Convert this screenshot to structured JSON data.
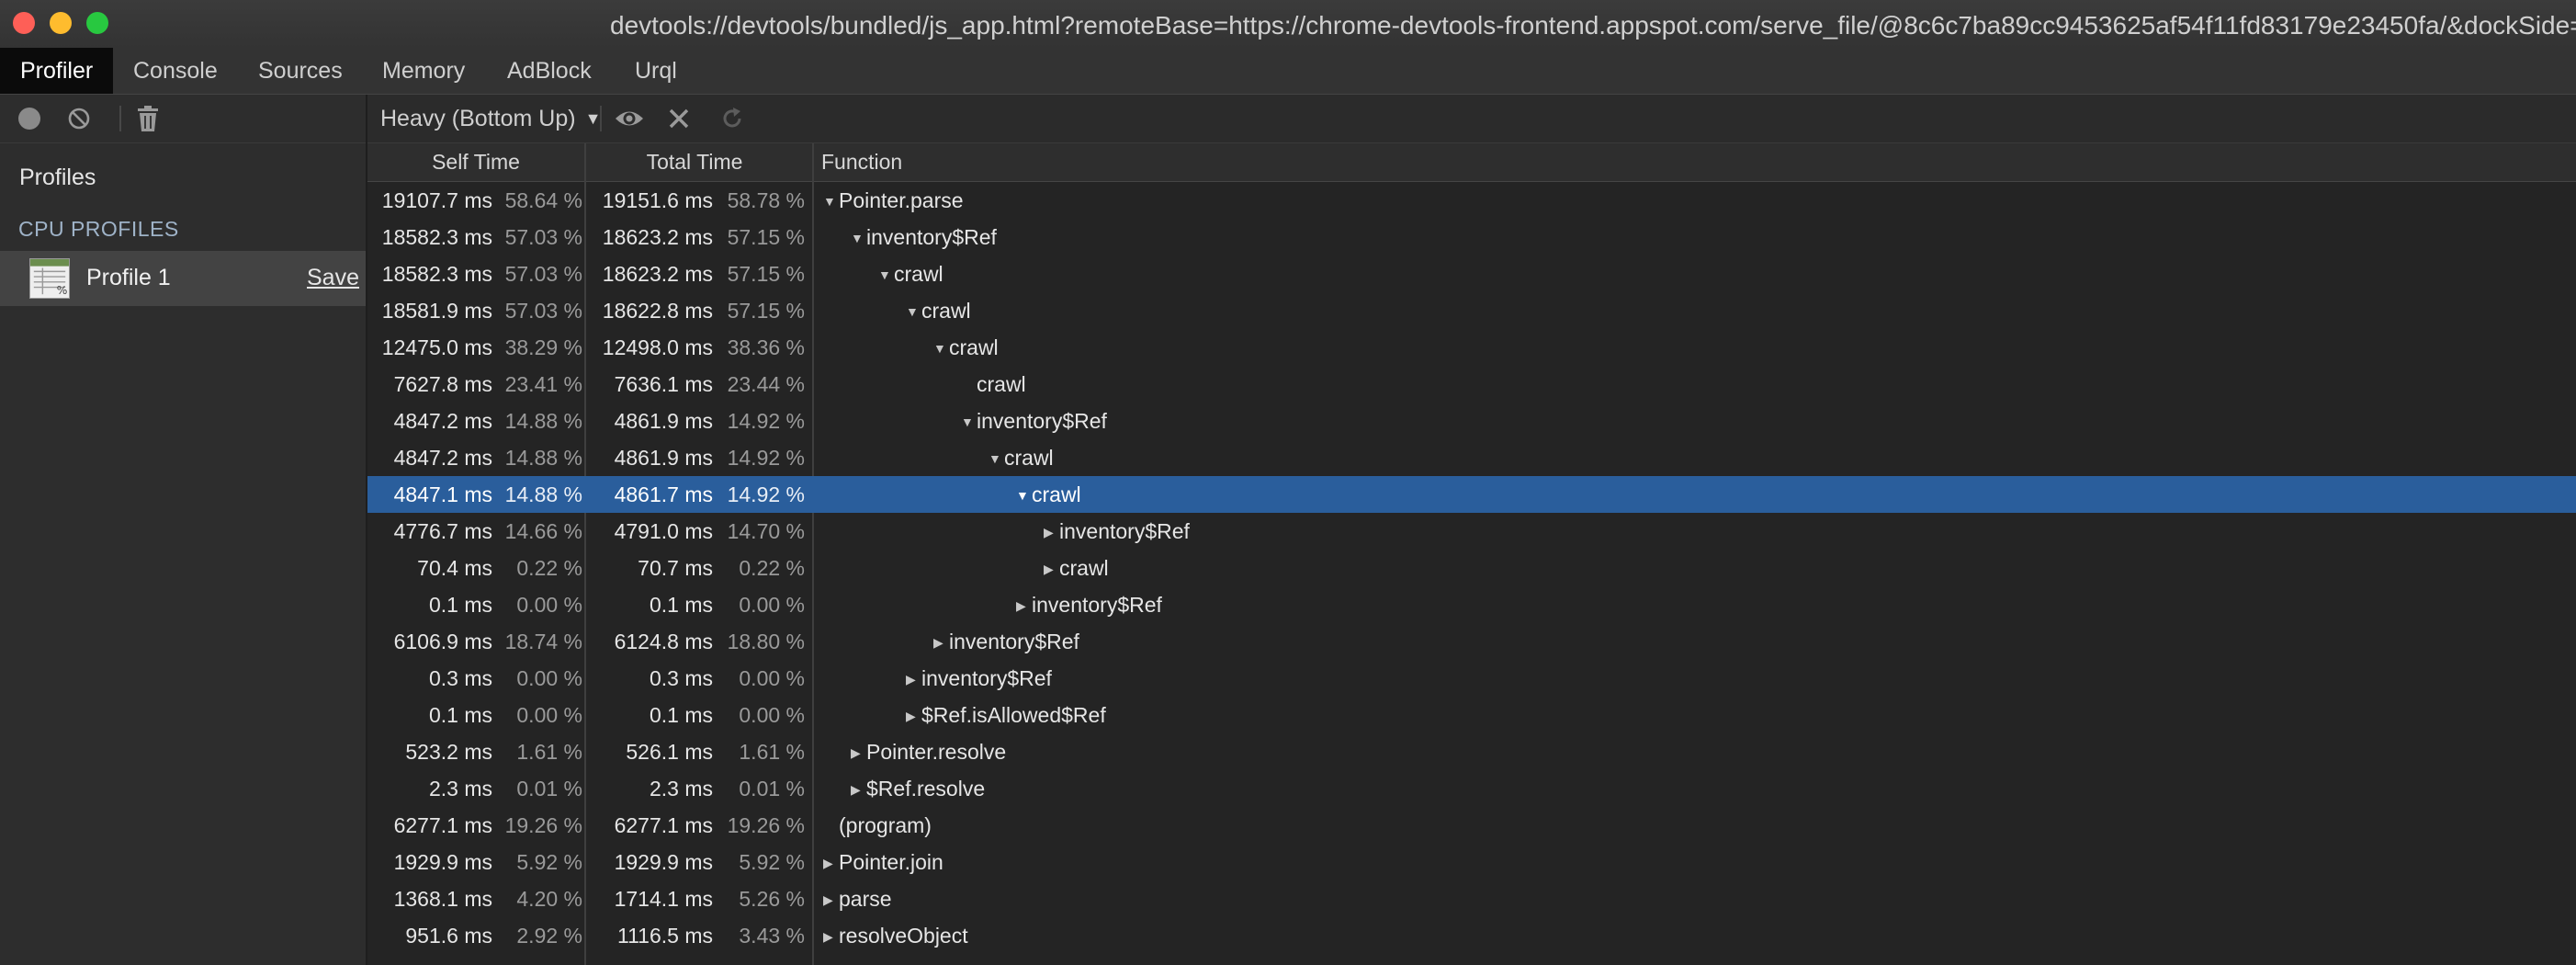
{
  "window": {
    "title": "devtools://devtools/bundled/js_app.html?remoteBase=https://chrome-devtools-frontend.appspot.com/serve_file/@8c6c7ba89cc9453625af54f11fd83179e23450fa/&dockSide=u"
  },
  "tabs": [
    "Profiler",
    "Console",
    "Sources",
    "Memory",
    "AdBlock",
    "Urql"
  ],
  "sidebar": {
    "profiles_heading": "Profiles",
    "section_heading": "CPU PROFILES",
    "profile_name": "Profile 1",
    "save_label": "Save"
  },
  "toolbar": {
    "view_mode": "Heavy (Bottom Up)"
  },
  "grid": {
    "columns": [
      "Self Time",
      "Total Time",
      "Function"
    ],
    "rows": [
      {
        "self_ms": "19107.7 ms",
        "self_pct": "58.64 %",
        "total_ms": "19151.6 ms",
        "total_pct": "58.78 %",
        "depth": 0,
        "toggle": "expanded",
        "name": "Pointer.parse"
      },
      {
        "self_ms": "18582.3 ms",
        "self_pct": "57.03 %",
        "total_ms": "18623.2 ms",
        "total_pct": "57.15 %",
        "depth": 1,
        "toggle": "expanded",
        "name": "inventory$Ref"
      },
      {
        "self_ms": "18582.3 ms",
        "self_pct": "57.03 %",
        "total_ms": "18623.2 ms",
        "total_pct": "57.15 %",
        "depth": 2,
        "toggle": "expanded",
        "name": "crawl"
      },
      {
        "self_ms": "18581.9 ms",
        "self_pct": "57.03 %",
        "total_ms": "18622.8 ms",
        "total_pct": "57.15 %",
        "depth": 3,
        "toggle": "expanded",
        "name": "crawl"
      },
      {
        "self_ms": "12475.0 ms",
        "self_pct": "38.29 %",
        "total_ms": "12498.0 ms",
        "total_pct": "38.36 %",
        "depth": 4,
        "toggle": "expanded",
        "name": "crawl"
      },
      {
        "self_ms": "7627.8 ms",
        "self_pct": "23.41 %",
        "total_ms": "7636.1 ms",
        "total_pct": "23.44 %",
        "depth": 5,
        "toggle": "none",
        "name": "crawl"
      },
      {
        "self_ms": "4847.2 ms",
        "self_pct": "14.88 %",
        "total_ms": "4861.9 ms",
        "total_pct": "14.92 %",
        "depth": 5,
        "toggle": "expanded",
        "name": "inventory$Ref"
      },
      {
        "self_ms": "4847.2 ms",
        "self_pct": "14.88 %",
        "total_ms": "4861.9 ms",
        "total_pct": "14.92 %",
        "depth": 6,
        "toggle": "expanded",
        "name": "crawl"
      },
      {
        "self_ms": "4847.1 ms",
        "self_pct": "14.88 %",
        "total_ms": "4861.7 ms",
        "total_pct": "14.92 %",
        "depth": 7,
        "toggle": "expanded",
        "name": "crawl",
        "selected": true
      },
      {
        "self_ms": "4776.7 ms",
        "self_pct": "14.66 %",
        "total_ms": "4791.0 ms",
        "total_pct": "14.70 %",
        "depth": 8,
        "toggle": "collapsed",
        "name": "inventory$Ref"
      },
      {
        "self_ms": "70.4 ms",
        "self_pct": "0.22 %",
        "total_ms": "70.7 ms",
        "total_pct": "0.22 %",
        "depth": 8,
        "toggle": "collapsed",
        "name": "crawl"
      },
      {
        "self_ms": "0.1 ms",
        "self_pct": "0.00 %",
        "total_ms": "0.1 ms",
        "total_pct": "0.00 %",
        "depth": 7,
        "toggle": "collapsed",
        "name": "inventory$Ref"
      },
      {
        "self_ms": "6106.9 ms",
        "self_pct": "18.74 %",
        "total_ms": "6124.8 ms",
        "total_pct": "18.80 %",
        "depth": 4,
        "toggle": "collapsed",
        "name": "inventory$Ref"
      },
      {
        "self_ms": "0.3 ms",
        "self_pct": "0.00 %",
        "total_ms": "0.3 ms",
        "total_pct": "0.00 %",
        "depth": 3,
        "toggle": "collapsed",
        "name": "inventory$Ref"
      },
      {
        "self_ms": "0.1 ms",
        "self_pct": "0.00 %",
        "total_ms": "0.1 ms",
        "total_pct": "0.00 %",
        "depth": 3,
        "toggle": "collapsed",
        "name": "$Ref.isAllowed$Ref"
      },
      {
        "self_ms": "523.2 ms",
        "self_pct": "1.61 %",
        "total_ms": "526.1 ms",
        "total_pct": "1.61 %",
        "depth": 1,
        "toggle": "collapsed",
        "name": "Pointer.resolve"
      },
      {
        "self_ms": "2.3 ms",
        "self_pct": "0.01 %",
        "total_ms": "2.3 ms",
        "total_pct": "0.01 %",
        "depth": 1,
        "toggle": "collapsed",
        "name": "$Ref.resolve"
      },
      {
        "self_ms": "6277.1 ms",
        "self_pct": "19.26 %",
        "total_ms": "6277.1 ms",
        "total_pct": "19.26 %",
        "depth": 0,
        "toggle": "none",
        "name": "(program)"
      },
      {
        "self_ms": "1929.9 ms",
        "self_pct": "5.92 %",
        "total_ms": "1929.9 ms",
        "total_pct": "5.92 %",
        "depth": 0,
        "toggle": "collapsed",
        "name": "Pointer.join"
      },
      {
        "self_ms": "1368.1 ms",
        "self_pct": "4.20 %",
        "total_ms": "1714.1 ms",
        "total_pct": "5.26 %",
        "depth": 0,
        "toggle": "collapsed",
        "name": "parse"
      },
      {
        "self_ms": "951.6 ms",
        "self_pct": "2.92 %",
        "total_ms": "1116.5 ms",
        "total_pct": "3.43 %",
        "depth": 0,
        "toggle": "collapsed",
        "name": "resolveObject"
      }
    ]
  },
  "colors": {
    "selection": "#2a5e9c",
    "active_tab": "#0b0b0b",
    "background": "#242424"
  }
}
